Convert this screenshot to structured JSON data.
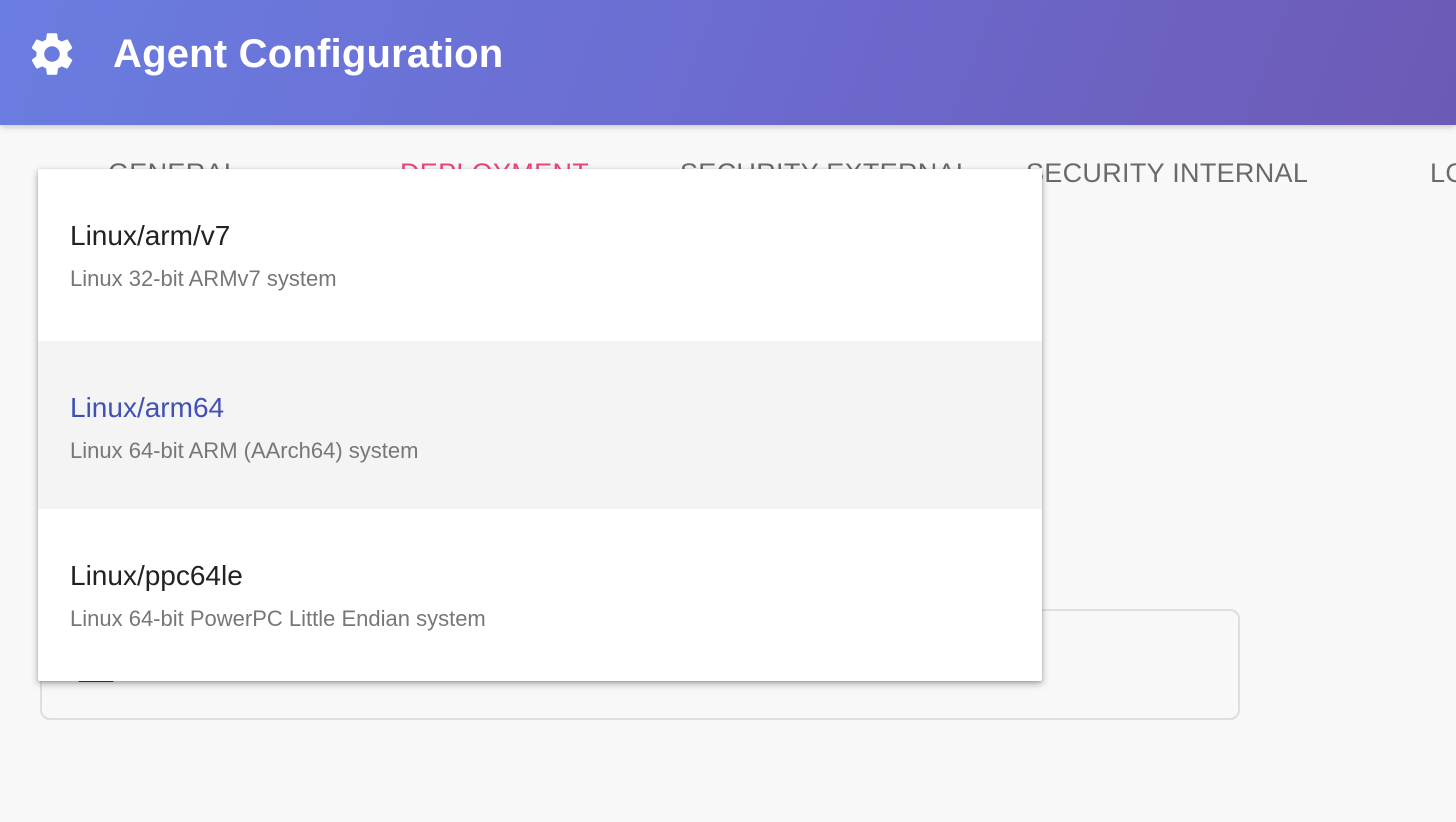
{
  "header": {
    "title": "Agent Configuration",
    "icon": "gear-icon",
    "gradient": [
      "#6a7de0",
      "#6d5ab5"
    ]
  },
  "tabs": [
    {
      "label": "GENERAL",
      "active": false
    },
    {
      "label": "DEPLOYMENT",
      "active": true
    },
    {
      "label": "SECURITY EXTERNAL",
      "active": false
    },
    {
      "label": "SECURITY INTERNAL",
      "active": false
    },
    {
      "label": "LO",
      "active": false
    }
  ],
  "accent_color": "#e8457d",
  "selected_color": "#3f51b5",
  "dropdown": {
    "items": [
      {
        "title": "Linux/arm/v7",
        "description": "Linux 32-bit ARMv7 system",
        "selected": false
      },
      {
        "title": "Linux/arm64",
        "description": "Linux 64-bit ARM (AArch64) system",
        "selected": true
      },
      {
        "title": "Linux/ppc64le",
        "description": "Linux 64-bit PowerPC Little Endian system",
        "selected": false
      }
    ]
  }
}
